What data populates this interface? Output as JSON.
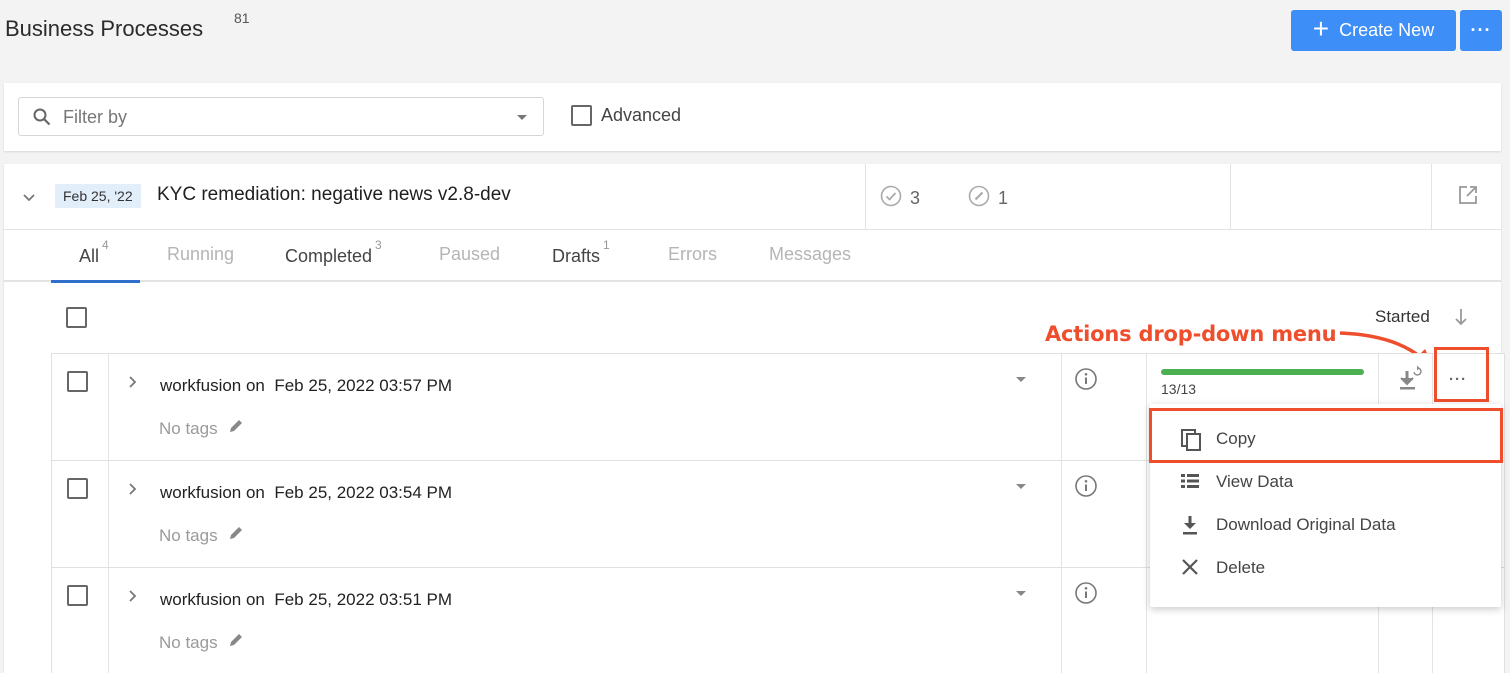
{
  "header": {
    "title": "Business Processes",
    "count": "81",
    "create_label": "Create New",
    "more_label": "···"
  },
  "filter": {
    "placeholder": "Filter by",
    "advanced_label": "Advanced"
  },
  "process": {
    "date_chip": "Feb 25, '22",
    "name": "KYC remediation: negative news v2.8-dev",
    "completed_count": "3",
    "draft_count": "1"
  },
  "tabs": [
    {
      "label": "All",
      "count": "4",
      "active": true
    },
    {
      "label": "Running",
      "count": "",
      "disabled": true
    },
    {
      "label": "Completed",
      "count": "3"
    },
    {
      "label": "Paused",
      "count": "",
      "disabled": true
    },
    {
      "label": "Drafts",
      "count": "1"
    },
    {
      "label": "Errors",
      "count": "",
      "disabled": true
    },
    {
      "label": "Messages",
      "count": "",
      "disabled": true
    }
  ],
  "list": {
    "sort_label": "Started",
    "rows": [
      {
        "user": "workfusion on",
        "date": "Feb 25, 2022 03:57 PM",
        "tags": "No tags",
        "progress_text": "13/13",
        "progress_fraction": 1.0
      },
      {
        "user": "workfusion on",
        "date": "Feb 25, 2022 03:54 PM",
        "tags": "No tags"
      },
      {
        "user": "workfusion on",
        "date": "Feb 25, 2022 03:51 PM",
        "tags": "No tags"
      }
    ]
  },
  "annotation": "Actions drop-down menu",
  "annotation_color": "#ef4e2d",
  "accent_color": "#3d8ef7",
  "actions_menu": {
    "items": [
      {
        "label": "Copy",
        "icon": "copy-icon"
      },
      {
        "label": "View Data",
        "icon": "view-data-icon"
      },
      {
        "label": "Download Original Data",
        "icon": "download-icon"
      },
      {
        "label": "Delete",
        "icon": "close-icon"
      }
    ]
  }
}
